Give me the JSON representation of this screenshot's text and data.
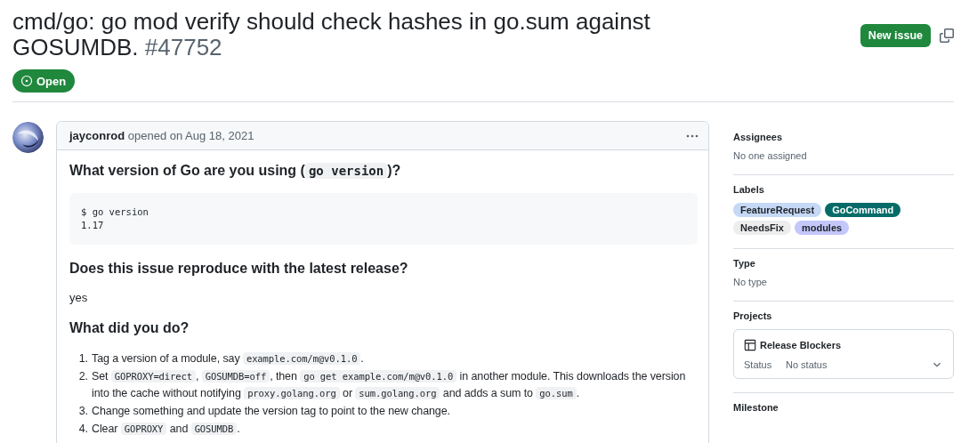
{
  "issue": {
    "title": "cmd/go: go mod verify should check hashes in go.sum against GOSUMDB.",
    "number": "#47752",
    "state": {
      "kind": "open",
      "label": "Open"
    }
  },
  "actions": {
    "new_issue": "New issue"
  },
  "comment": {
    "author": "jayconrod",
    "meta": "opened on Aug 18, 2021",
    "body": [
      {
        "kind": "heading",
        "parts": [
          {
            "kind": "text",
            "text": "What version of Go are you using ("
          },
          {
            "kind": "code",
            "text": "go version"
          },
          {
            "kind": "text",
            "text": ")?"
          }
        ]
      },
      {
        "kind": "codeblock",
        "lines": [
          "$ go version",
          "1.17"
        ]
      },
      {
        "kind": "heading",
        "parts": [
          {
            "kind": "text",
            "text": "Does this issue reproduce with the latest release?"
          }
        ]
      },
      {
        "kind": "paragraph",
        "parts": [
          {
            "kind": "text",
            "text": "yes"
          }
        ]
      },
      {
        "kind": "heading",
        "parts": [
          {
            "kind": "text",
            "text": "What did you do?"
          }
        ]
      },
      {
        "kind": "list",
        "items": [
          {
            "number": "1.",
            "parts": [
              {
                "kind": "text",
                "text": "Tag a version of a module, say "
              },
              {
                "kind": "code",
                "text": "example.com/m@v0.1.0"
              },
              {
                "kind": "text",
                "text": "."
              }
            ]
          },
          {
            "number": "2.",
            "parts": [
              {
                "kind": "text",
                "text": "Set "
              },
              {
                "kind": "code",
                "text": "GOPROXY=direct"
              },
              {
                "kind": "text",
                "text": ", "
              },
              {
                "kind": "code",
                "text": "GOSUMDB=off"
              },
              {
                "kind": "text",
                "text": ", then "
              },
              {
                "kind": "code",
                "text": "go get example.com/m@v0.1.0"
              },
              {
                "kind": "text",
                "text": " in another module. This downloads the version into the cache without notifying "
              },
              {
                "kind": "code",
                "text": "proxy.golang.org"
              },
              {
                "kind": "text",
                "text": " or "
              },
              {
                "kind": "code",
                "text": "sum.golang.org"
              },
              {
                "kind": "text",
                "text": " and adds a sum to "
              },
              {
                "kind": "code",
                "text": "go.sum"
              },
              {
                "kind": "text",
                "text": "."
              }
            ]
          },
          {
            "number": "3.",
            "parts": [
              {
                "kind": "text",
                "text": "Change something and update the version tag to point to the new change."
              }
            ]
          },
          {
            "number": "4.",
            "parts": [
              {
                "kind": "text",
                "text": "Clear "
              },
              {
                "kind": "code",
                "text": "GOPROXY"
              },
              {
                "kind": "text",
                "text": " and "
              },
              {
                "kind": "code",
                "text": "GOSUMDB"
              },
              {
                "kind": "text",
                "text": "."
              }
            ]
          }
        ]
      }
    ]
  },
  "sidebar": {
    "assignees": {
      "heading": "Assignees",
      "value": "No one assigned"
    },
    "labels": {
      "heading": "Labels",
      "items": [
        {
          "text": "FeatureRequest",
          "color": "#c5d8f6"
        },
        {
          "text": "GoCommand",
          "color": "#066b68"
        },
        {
          "text": "NeedsFix",
          "color": "#ededed"
        },
        {
          "text": "modules",
          "color": "#c3c7fa"
        }
      ]
    },
    "type": {
      "heading": "Type",
      "value": "No type"
    },
    "projects": {
      "heading": "Projects",
      "project": {
        "name": "Release Blockers",
        "status_label": "Status",
        "status": "No status"
      }
    },
    "milestone": {
      "heading": "Milestone"
    }
  }
}
